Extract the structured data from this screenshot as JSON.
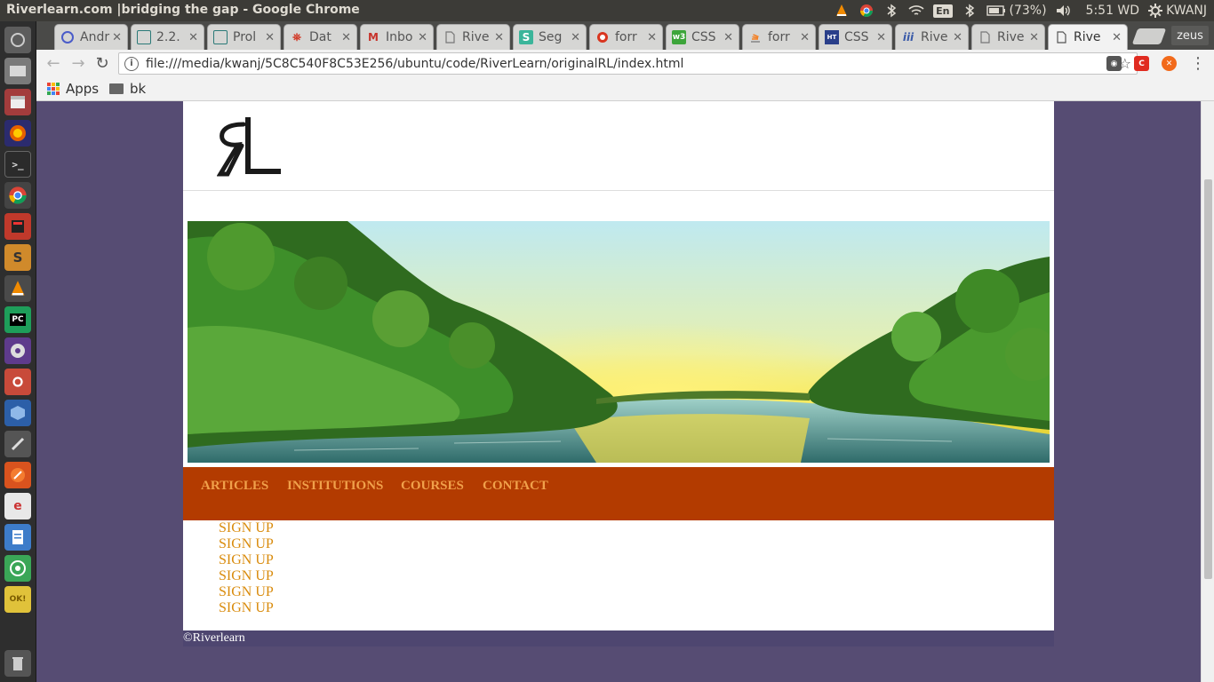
{
  "panel": {
    "window_title": "Riverlearn.com |bridging the gap - Google Chrome",
    "input_lang": "En",
    "battery": "(73%)",
    "clock": "5:51 WD",
    "user": "KWANJ"
  },
  "tabs": [
    {
      "label": "Andr",
      "fav_color": "#4a5cc9"
    },
    {
      "label": "2.2.",
      "fav_color": "#2b7a78"
    },
    {
      "label": "Prol",
      "fav_color": "#2b7a78"
    },
    {
      "label": "Dat",
      "fav_color": "#d23c2a"
    },
    {
      "label": "Inbo",
      "fav_color": "#c7332b"
    },
    {
      "label": "Rive",
      "fav_color": "#777777"
    },
    {
      "label": "Seg",
      "fav_color": "#3bb59a"
    },
    {
      "label": "forr",
      "fav_color": "#d9351f"
    },
    {
      "label": "CSS",
      "fav_color": "#3da53a"
    },
    {
      "label": "forr",
      "fav_color": "#f48024"
    },
    {
      "label": "CSS",
      "fav_color": "#2a3f8a"
    },
    {
      "label": "Rive",
      "fav_color": "#3859a8"
    },
    {
      "label": "Rive",
      "fav_color": "#777777"
    },
    {
      "label": "Rive",
      "fav_color": "#777777"
    }
  ],
  "profile_name": "zeus",
  "omnibox": {
    "url": "file:///media/kwanj/5C8C540F8C53E256/ubuntu/code/RiverLearn/originalRL/index.html"
  },
  "bookmarks": {
    "apps": "Apps",
    "folder": "bk"
  },
  "site": {
    "logo_text": "RL",
    "nav": [
      "ARTICLES",
      "INSTITUTIONS",
      "COURSES",
      "CONTACT"
    ],
    "signup_links": [
      "SIGN UP",
      "SIGN UP",
      "SIGN UP",
      "SIGN UP",
      "SIGN UP",
      "SIGN UP"
    ],
    "footer": "©Riverlearn"
  },
  "colors": {
    "page_bg": "#564c73",
    "navbar_bg": "#b33b00",
    "nav_link": "#f0a04a",
    "signup_link": "#d98b0c"
  }
}
